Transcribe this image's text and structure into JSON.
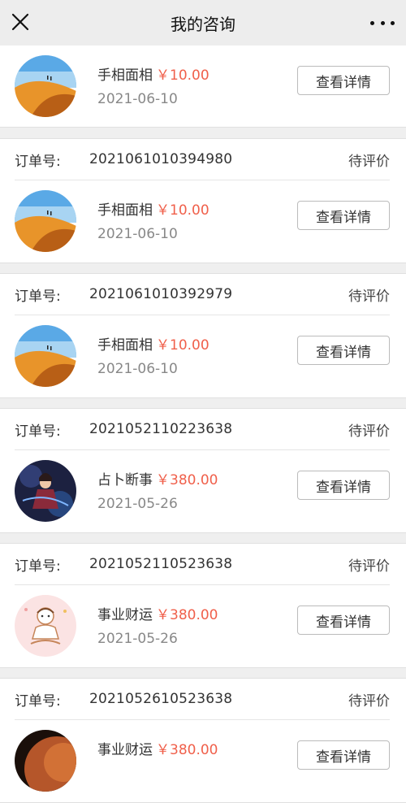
{
  "header": {
    "title": "我的咨询",
    "close_icon": "close-icon",
    "more_icon": "more-dots-icon"
  },
  "orders": [
    {
      "order_label": "",
      "order_no": "",
      "status": "",
      "service": "手相面相",
      "price": "￥10.00",
      "date": "2021-06-10",
      "button": "查看详情",
      "avatar": "desert"
    },
    {
      "order_label": "订单号:",
      "order_no": "2021061010394980",
      "status": "待评价",
      "service": "手相面相",
      "price": "￥10.00",
      "date": "2021-06-10",
      "button": "查看详情",
      "avatar": "desert"
    },
    {
      "order_label": "订单号:",
      "order_no": "2021061010392979",
      "status": "待评价",
      "service": "手相面相",
      "price": "￥10.00",
      "date": "2021-06-10",
      "button": "查看详情",
      "avatar": "desert"
    },
    {
      "order_label": "订单号:",
      "order_no": "2021052110223638",
      "status": "待评价",
      "service": "占卜断事",
      "price": "￥380.00",
      "date": "2021-05-26",
      "button": "查看详情",
      "avatar": "warrior"
    },
    {
      "order_label": "订单号:",
      "order_no": "2021052110523638",
      "status": "待评价",
      "service": "事业财运",
      "price": "￥380.00",
      "date": "2021-05-26",
      "button": "查看详情",
      "avatar": "cartoon"
    },
    {
      "order_label": "订单号:",
      "order_no": "2021052610523638",
      "status": "待评价",
      "service": "事业财运",
      "price": "￥380.00",
      "date": "",
      "button": "查看详情",
      "avatar": "planet"
    }
  ],
  "colors": {
    "price": "#f0604b",
    "background": "#efefef"
  }
}
